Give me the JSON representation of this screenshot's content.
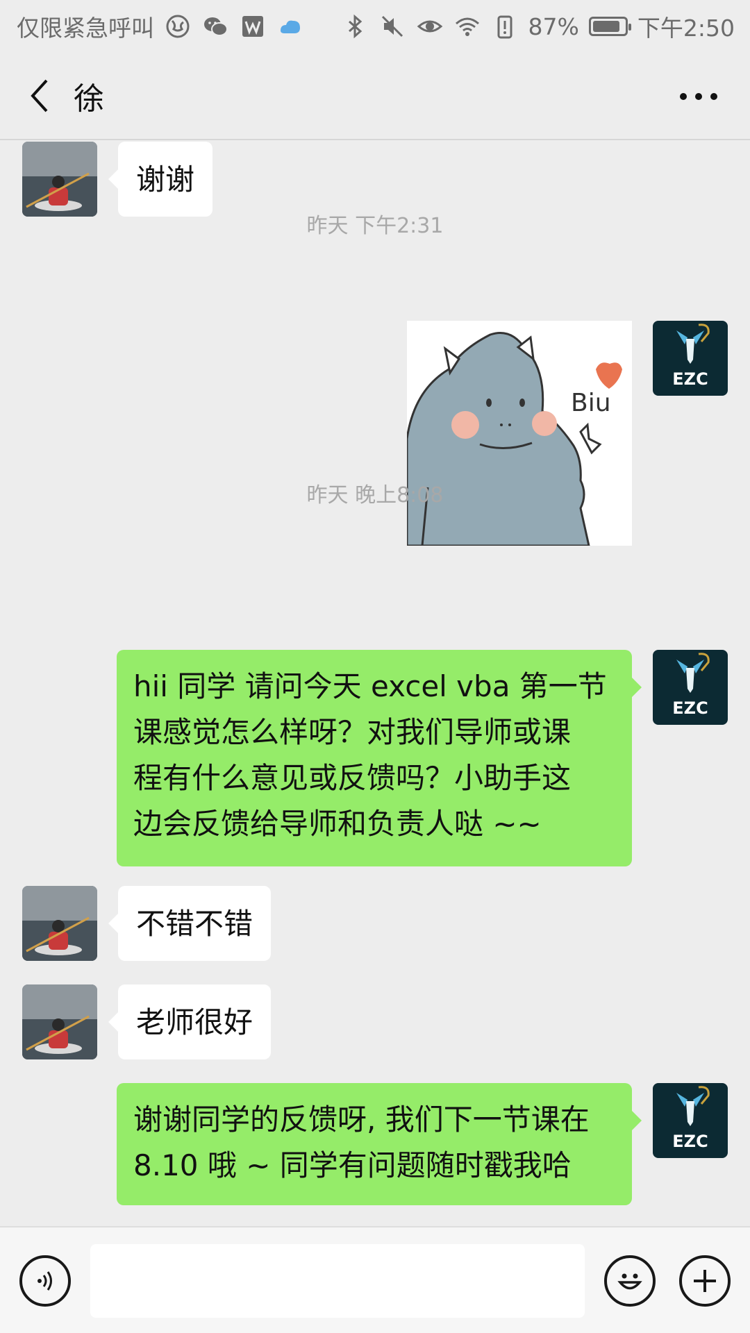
{
  "status_bar": {
    "carrier": "仅限紧急呼叫",
    "battery_percent": "87%",
    "time": "下午2:50",
    "battery_level": 0.87,
    "icons_left": [
      "globe-icon",
      "wechat-icon",
      "wps-icon",
      "cloud-icon"
    ],
    "icons_right": [
      "bluetooth-icon",
      "mute-icon",
      "eye-icon",
      "wifi-icon",
      "battery-alert-icon"
    ]
  },
  "header": {
    "title": "徐"
  },
  "messages": {
    "m1": {
      "side": "left",
      "text": "谢谢"
    },
    "t1": {
      "text": "昨天 下午2:31"
    },
    "m2": {
      "side": "right",
      "type": "sticker",
      "caption": "Biu"
    },
    "t2": {
      "text": "昨天 晚上8:08"
    },
    "m3": {
      "side": "right",
      "lines": [
        "hii 同学 请问今天 excel vba 第一节",
        "课感觉怎么样呀？对我们导师或课",
        "程有什么意见或反馈吗？小助手这",
        "边会反馈给导师和负责人哒 ~~"
      ]
    },
    "m4": {
      "side": "left",
      "text": "不错不错"
    },
    "m5": {
      "side": "left",
      "text": "老师很好"
    },
    "m6": {
      "side": "right",
      "lines": [
        "谢谢同学的反馈呀, 我们下一节课在",
        "8.10 哦 ~ 同学有问题随时戳我哈"
      ]
    }
  },
  "avatars": {
    "ezc_label": "EZC"
  },
  "input": {
    "value": ""
  },
  "colors": {
    "background": "#ededed",
    "bubble_self": "#95ec69",
    "bubble_other": "#ffffff",
    "timestamp": "#a8a8a8"
  }
}
